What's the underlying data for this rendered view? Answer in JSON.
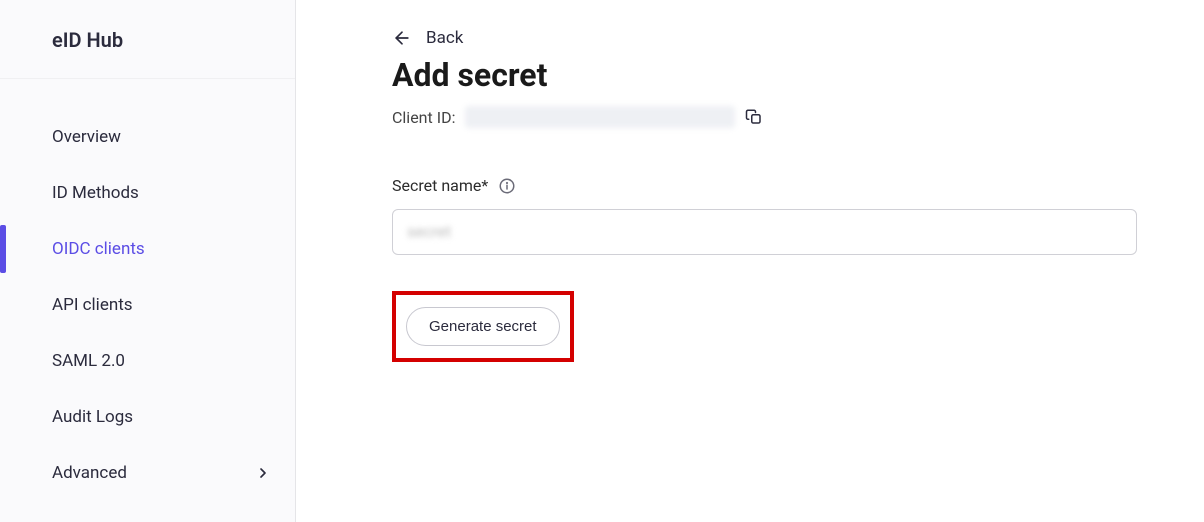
{
  "brand": {
    "title": "eID Hub"
  },
  "sidebar": {
    "items": [
      {
        "label": "Overview"
      },
      {
        "label": "ID Methods"
      },
      {
        "label": "OIDC clients"
      },
      {
        "label": "API clients"
      },
      {
        "label": "SAML 2.0"
      },
      {
        "label": "Audit Logs"
      },
      {
        "label": "Advanced"
      }
    ]
  },
  "header": {
    "back_label": "Back",
    "page_title": "Add secret",
    "client_id_label": "Client ID:"
  },
  "form": {
    "secret_name_label": "Secret name",
    "required_mark": "*",
    "generate_button_label": "Generate secret"
  }
}
